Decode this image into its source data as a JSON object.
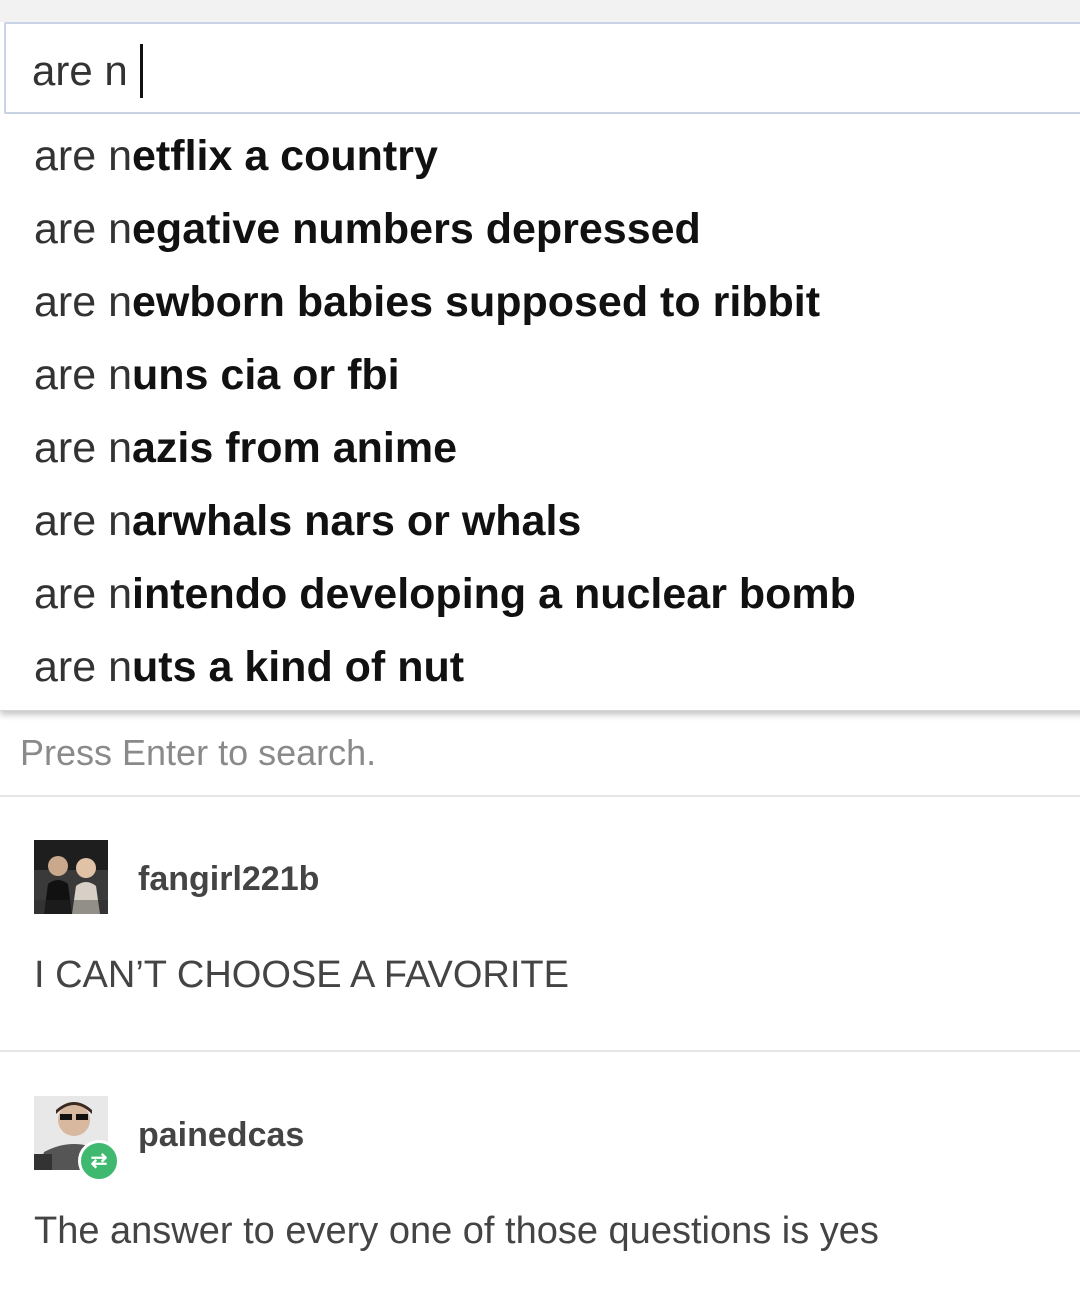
{
  "search": {
    "value": "are n",
    "typed_prefix": "are n",
    "suggestions": [
      {
        "typed": "are n",
        "rest": "etflix a country"
      },
      {
        "typed": "are n",
        "rest": "egative numbers depressed"
      },
      {
        "typed": "are n",
        "rest": "ewborn babies supposed to ribbit"
      },
      {
        "typed": "are n",
        "rest": "uns cia or fbi"
      },
      {
        "typed": "are n",
        "rest": "azis from anime"
      },
      {
        "typed": "are n",
        "rest": "arwhals nars or whals"
      },
      {
        "typed": "are n",
        "rest": "intendo developing a nuclear bomb"
      },
      {
        "typed": "are n",
        "rest": "uts a kind of nut"
      }
    ],
    "hint": "Press Enter to search."
  },
  "posts": [
    {
      "username": "fangirl221b",
      "text": "I CAN’T CHOOSE A FAVORITE",
      "avatar_icon": "photo-avatar"
    },
    {
      "username": "painedcas",
      "text": "The answer to every one of those questions is yes",
      "avatar_icon": "photo-avatar",
      "badge_icon": "reblog-icon"
    }
  ],
  "colors": {
    "input_border": "#c9d5e6",
    "hint_text": "#8a8a8a",
    "reblog_badge": "#3fb96f"
  }
}
